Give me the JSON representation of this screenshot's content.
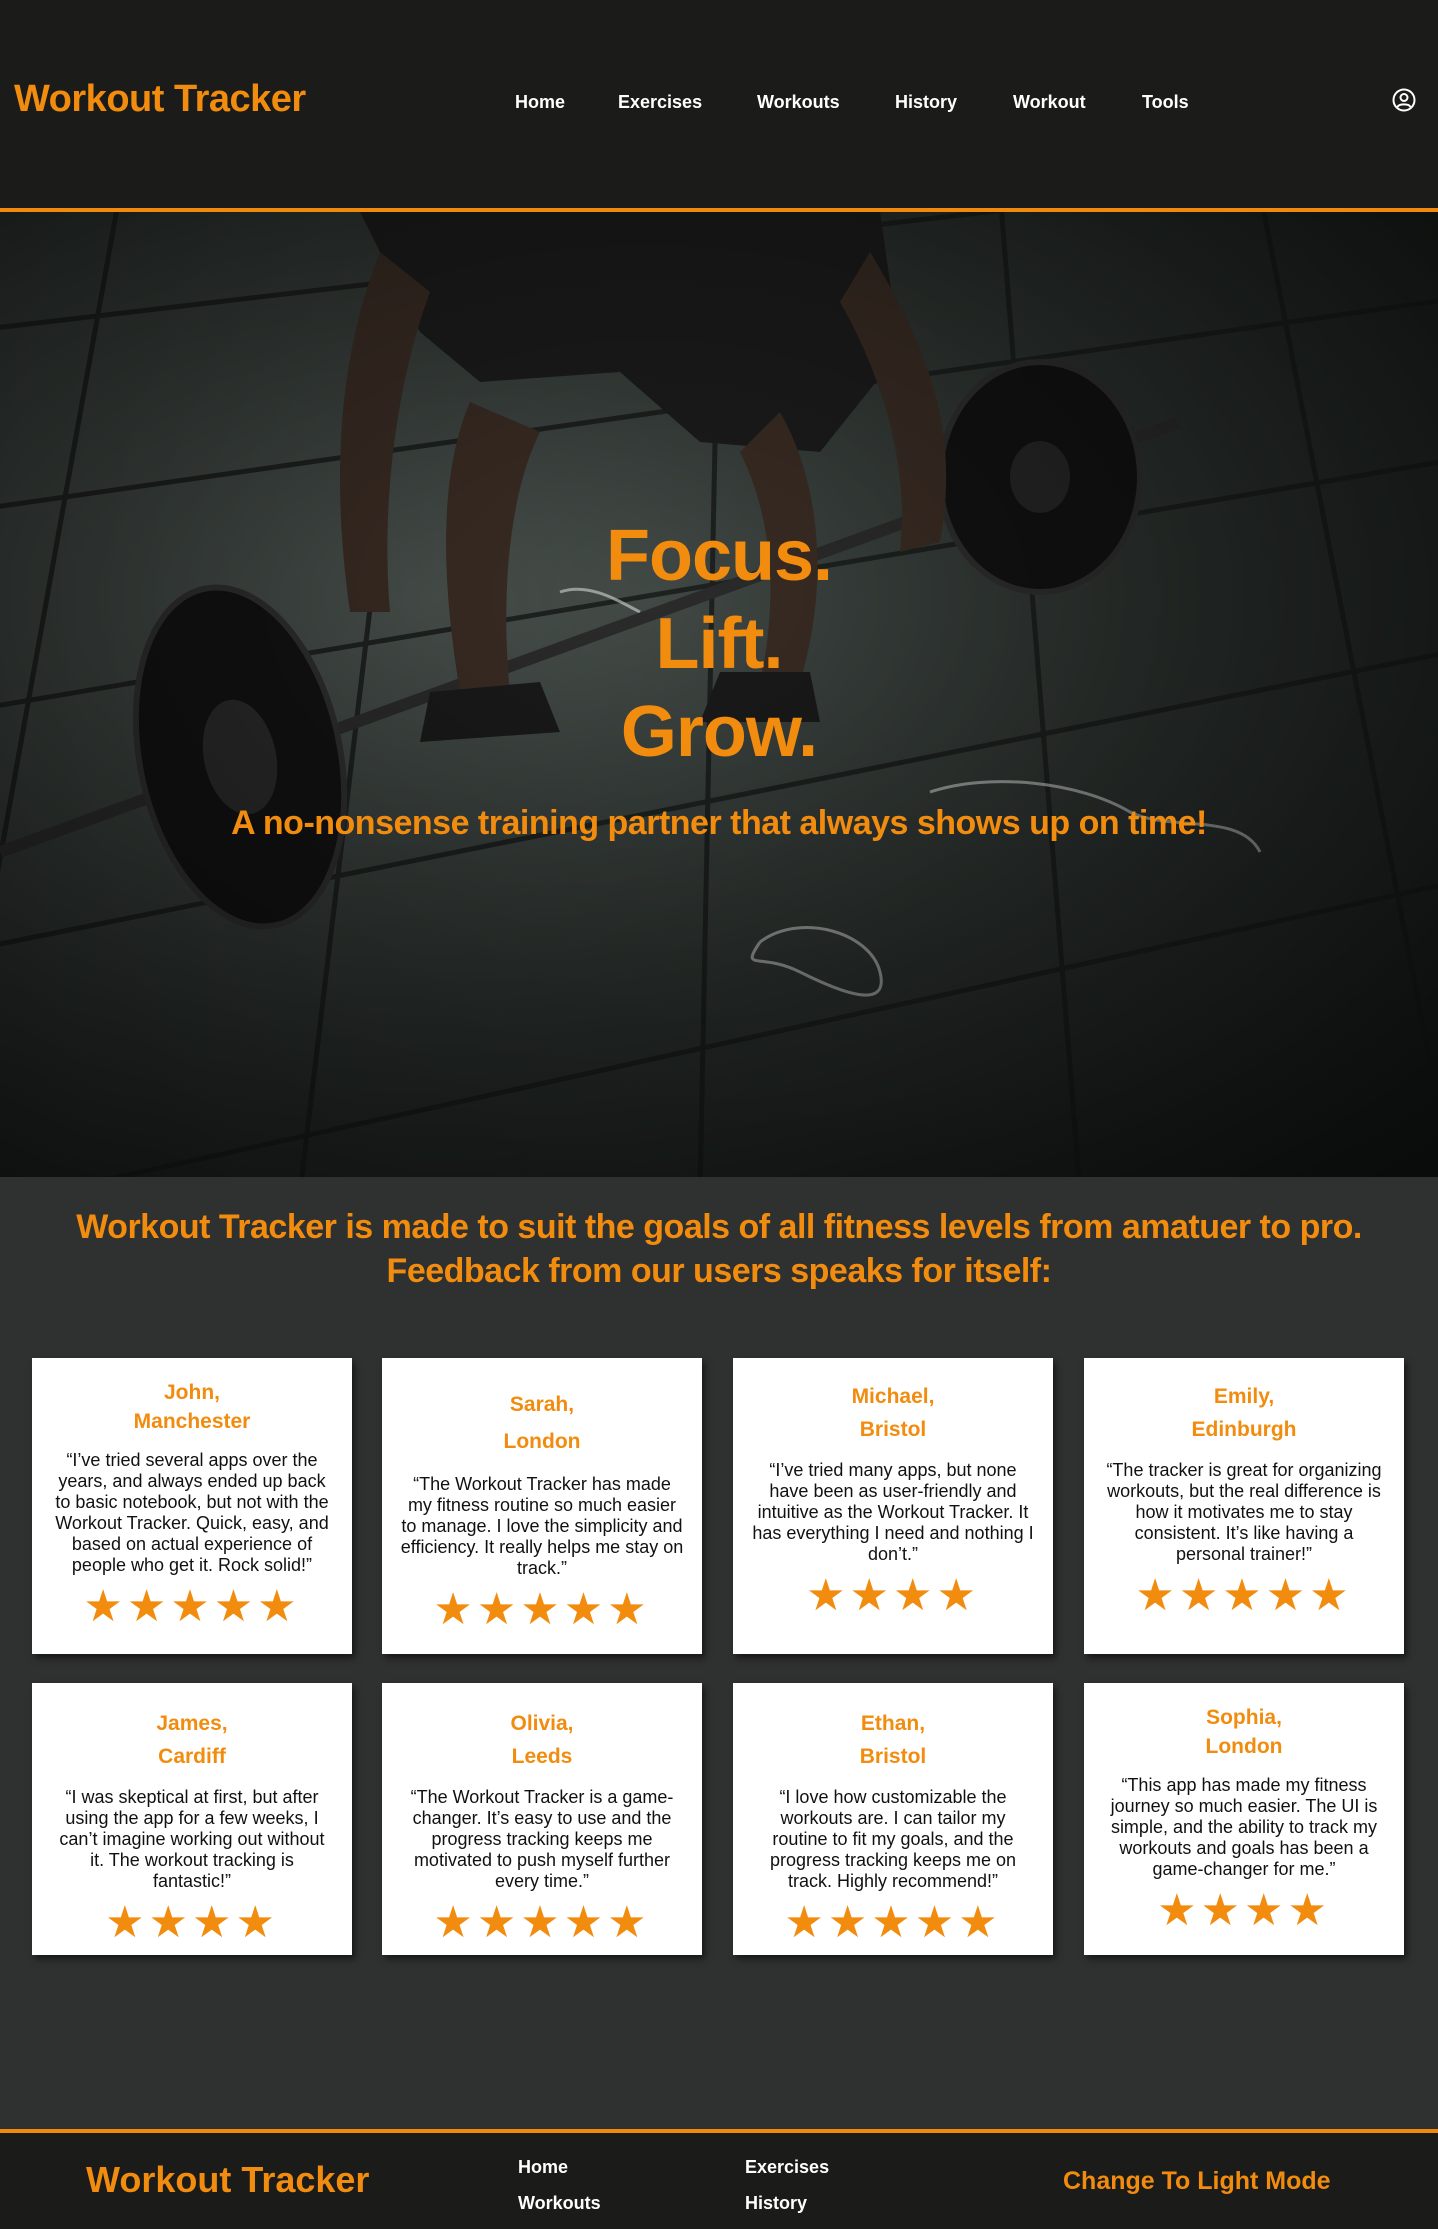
{
  "header": {
    "brand": "Workout Tracker",
    "nav": [
      "Home",
      "Exercises",
      "Workouts",
      "History",
      "Workout",
      "Tools"
    ],
    "profile_icon": "user-circle-icon"
  },
  "hero": {
    "line1": "Focus.",
    "line2": "Lift.",
    "line3": "Grow.",
    "subtitle": "A no-nonsense training partner that always shows up on time!"
  },
  "intro": "Workout Tracker is made to suit the goals of all fitness levels from amatuer to pro. Feedback from our users speaks for itself:",
  "testimonials": [
    {
      "name": "John,",
      "city": "Manchester",
      "quote": "“I’ve tried several apps over the years, and always ended up back to basic notebook, but not with the Workout Tracker. Quick, easy, and based on actual experience of people who get it. Rock solid!”",
      "stars": "★★★★★",
      "rating": 5
    },
    {
      "name": "Sarah,",
      "city": "London",
      "quote": "“The Workout Tracker has made my fitness routine so much easier to manage. I love the simplicity and efficiency. It really helps me stay on track.”",
      "stars": "★★★★★",
      "rating": 5
    },
    {
      "name": "Michael,",
      "city": "Bristol",
      "quote": "“I’ve tried many apps, but none have been as user-friendly and intuitive as the Workout Tracker. It has everything I need and nothing I don’t.”",
      "stars": "★★★★",
      "rating": 4
    },
    {
      "name": "Emily,",
      "city": "Edinburgh",
      "quote": "“The tracker is great for organizing workouts, but the real difference is how it motivates me to stay consistent. It’s like having a personal trainer!”",
      "stars": "★★★★★",
      "rating": 5
    },
    {
      "name": "James,",
      "city": "Cardiff",
      "quote": "“I was skeptical at first, but after using the app for a few weeks, I can’t imagine working out without it. The workout tracking is fantastic!”",
      "stars": "★★★★",
      "rating": 4
    },
    {
      "name": "Olivia,",
      "city": "Leeds",
      "quote": "“The Workout Tracker is a game-changer. It’s easy to use and the progress tracking keeps me motivated to push myself further every time.”",
      "stars": "★★★★★",
      "rating": 5
    },
    {
      "name": "Ethan,",
      "city": "Bristol",
      "quote": "“I love how customizable the workouts are. I can tailor my routine to fit my goals, and the progress tracking keeps me on track. Highly recommend!”",
      "stars": "★★★★★",
      "rating": 5
    },
    {
      "name": "Sophia,",
      "city": "London",
      "quote": "“This app has made my fitness journey so much easier. The UI is simple, and the ability to track my workouts and goals has been a game-changer for me.”",
      "stars": "★★★★",
      "rating": 4
    }
  ],
  "footer": {
    "brand": "Workout Tracker",
    "links": [
      "Home",
      "Exercises",
      "Workouts",
      "History"
    ],
    "mode_toggle": "Change To Light Mode"
  },
  "colors": {
    "accent": "#f28c0f",
    "header_bg": "#1b1b19",
    "body_bg": "#2f3030"
  }
}
